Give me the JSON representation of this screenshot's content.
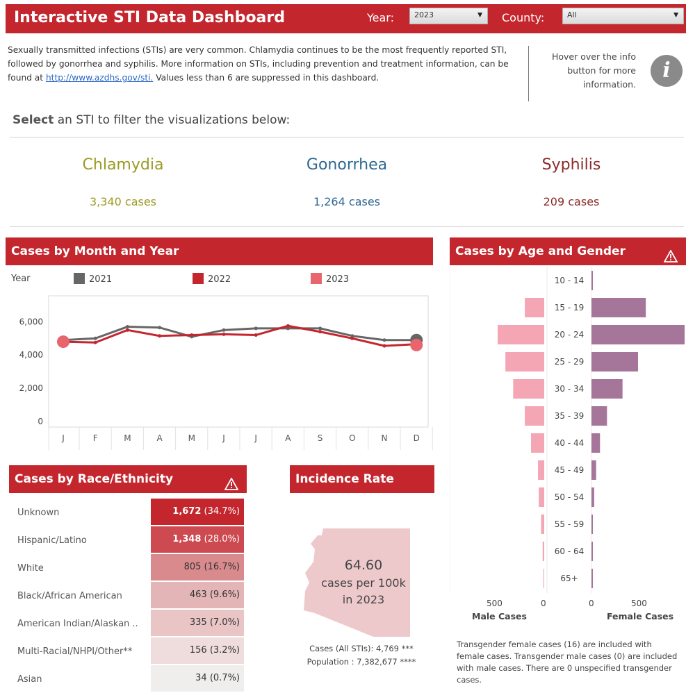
{
  "header": {
    "title": "Interactive STI Data Dashboard",
    "year_label": "Year:",
    "year_value": "2023",
    "county_label": "County:",
    "county_value": "All"
  },
  "intro": {
    "text_before_link": "Sexually transmitted infections (STIs) are very common. Chlamydia continues to be the most frequently reported STI, followed by gonorrhea and syphilis.  More information on STIs, including prevention and treatment information, can be found at ",
    "link": "http://www.azdhs.gov/sti.",
    "text_after_link": " Values less than 6 are suppressed in this dashboard."
  },
  "info": {
    "text": "Hover over the info button for more information.",
    "icon": "i"
  },
  "prompt": {
    "bold": "Select",
    "rest": " an STI to filter the visualizations below:"
  },
  "stis": [
    {
      "name": "Chlamydia",
      "count": "3,340",
      "unit": "cases",
      "color": "#9b9a23"
    },
    {
      "name": "Gonorrhea",
      "count": "1,264",
      "unit": "cases",
      "color": "#2e6893"
    },
    {
      "name": "Syphilis",
      "count": "209",
      "unit": "cases",
      "color": "#8c2a2a"
    }
  ],
  "sections": {
    "month_year": "Cases by Month and Year",
    "age_gender": "Cases by Age and Gender",
    "race": "Cases by Race/Ethnicity",
    "incidence": "Incidence Rate"
  },
  "chart_data": [
    {
      "type": "line",
      "title": "Cases by Month and Year",
      "legend_title": "Year",
      "legend_position": "top",
      "x": [
        "J",
        "F",
        "M",
        "A",
        "M",
        "J",
        "J",
        "A",
        "S",
        "O",
        "N",
        "D"
      ],
      "yticks": [
        "0",
        "2,000",
        "4,000",
        "6,000"
      ],
      "ylim": [
        0,
        7500
      ],
      "grid": false,
      "series": [
        {
          "name": "2021",
          "color": "#666666",
          "values": [
            4900,
            5000,
            5700,
            5650,
            5100,
            5500,
            5600,
            5600,
            5600,
            5150,
            4900,
            4900
          ]
        },
        {
          "name": "2022",
          "color": "#c4262e",
          "values": [
            4800,
            4750,
            5500,
            5150,
            5200,
            5250,
            5200,
            5750,
            5400,
            5000,
            4550,
            4650
          ]
        },
        {
          "name": "2023",
          "color": "#e8656d",
          "values": [
            4800,
            null,
            null,
            null,
            null,
            null,
            null,
            null,
            null,
            null,
            null,
            4600
          ]
        }
      ]
    },
    {
      "type": "bar",
      "title": "Cases by Age and Gender",
      "categories": [
        "10 - 14",
        "15 - 19",
        "20 - 24",
        "25 - 29",
        "30 - 34",
        "35 - 39",
        "40 - 44",
        "45 - 49",
        "50 - 54",
        "55 - 59",
        "60 - 64",
        "65+"
      ],
      "series": [
        {
          "name": "Male Cases",
          "color": "#f4a6b4",
          "values": [
            0,
            250,
            600,
            500,
            400,
            250,
            170,
            80,
            70,
            40,
            20,
            10
          ]
        },
        {
          "name": "Female Cases",
          "color": "#a5769a",
          "values": [
            15,
            700,
            1200,
            600,
            400,
            200,
            110,
            60,
            35,
            10,
            5,
            5
          ]
        }
      ],
      "x_ticks_left": [
        "500",
        "0"
      ],
      "x_ticks_right": [
        "0",
        "500"
      ],
      "xlabel_left": "Male Cases",
      "xlabel_right": "Female Cases"
    }
  ],
  "race_table": [
    {
      "label": "Unknown",
      "value": "1,672",
      "pct": "(34.7%)",
      "bg": "#c4262e",
      "fg": "#ffffff",
      "bold": true
    },
    {
      "label": "Hispanic/Latino",
      "value": "1,348",
      "pct": "(28.0%)",
      "bg": "#cc4a50",
      "fg": "#ffffff",
      "bold": true
    },
    {
      "label": "White",
      "value": "805",
      "pct": "(16.7%)",
      "bg": "#d98a8d",
      "fg": "#333333",
      "bold": false
    },
    {
      "label": "Black/African American",
      "value": "463",
      "pct": "(9.6%)",
      "bg": "#e4b5b6",
      "fg": "#333333",
      "bold": false
    },
    {
      "label": "American Indian/Alaskan ..",
      "value": "335",
      "pct": "(7.0%)",
      "bg": "#e9c5c6",
      "fg": "#333333",
      "bold": false
    },
    {
      "label": "Multi-Racial/NHPI/Other**",
      "value": "156",
      "pct": "(3.2%)",
      "bg": "#efdcdc",
      "fg": "#333333",
      "bold": false
    },
    {
      "label": "Asian",
      "value": "34",
      "pct": "(0.7%)",
      "bg": "#f0eded",
      "fg": "#333333",
      "bold": false
    }
  ],
  "incidence": {
    "rate": "64.60",
    "line2": "cases per 100k",
    "line3": "in 2023",
    "cases_line": "Cases (All STIs): 4,769 ***",
    "population_line": "Population : 7,382,677 ****"
  },
  "transgender_note": "Transgender female cases (16) are included with female cases. Transgender male cases (0) are included with male cases. There are 0 unspecified transgender cases.",
  "colors": {
    "brand": "#c4262e",
    "map_fill": "#eec9cc"
  }
}
